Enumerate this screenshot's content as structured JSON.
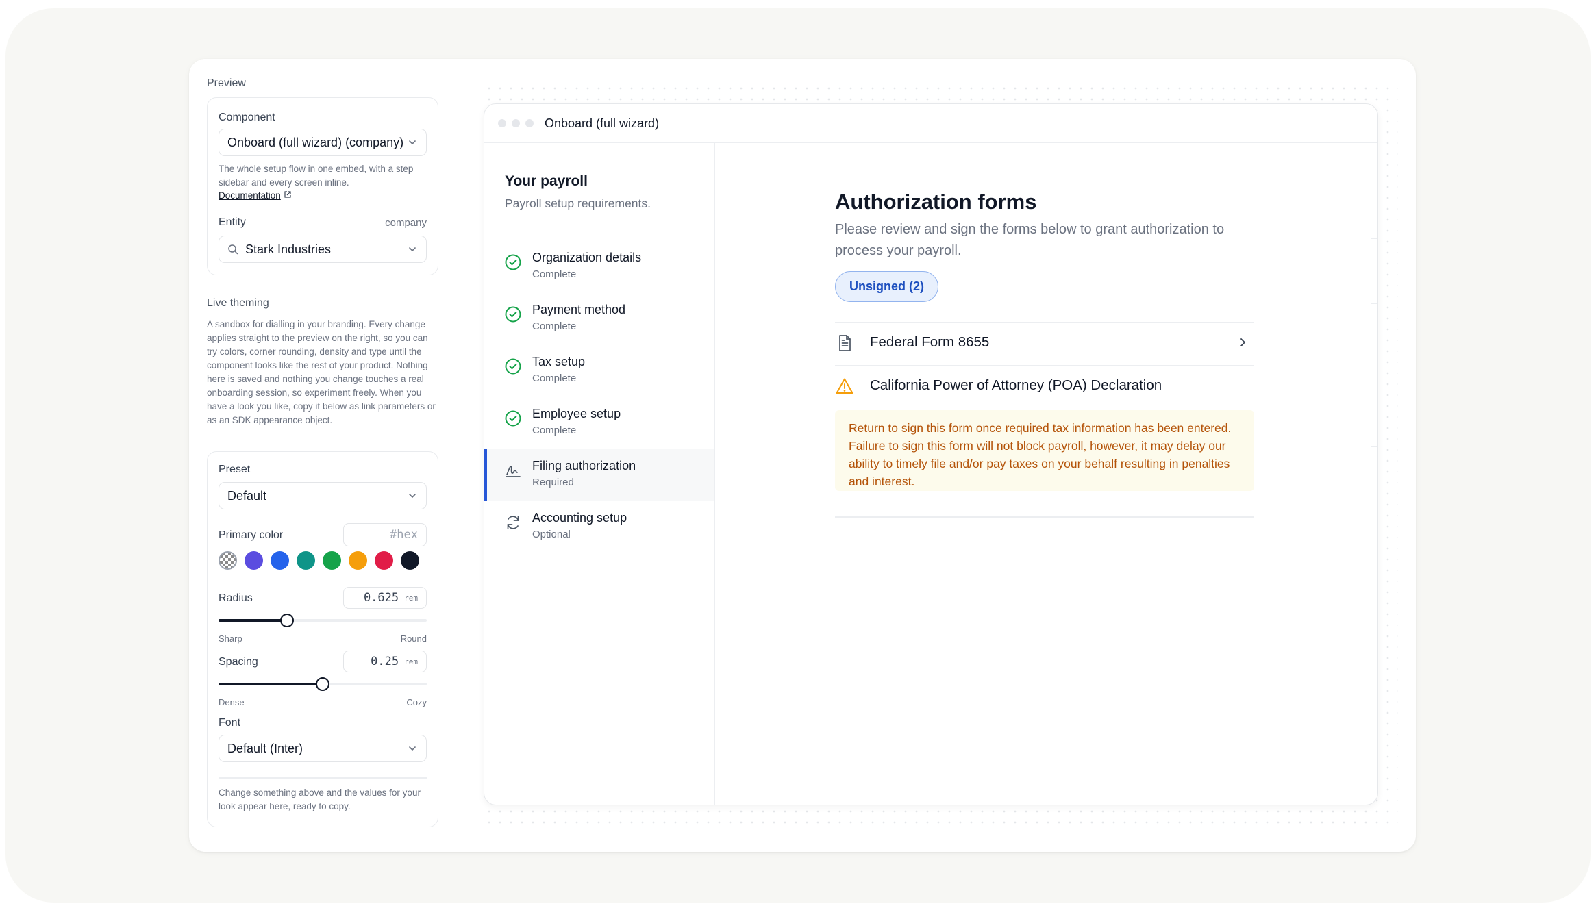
{
  "panel": {
    "preview_label": "Preview",
    "component": {
      "label": "Component",
      "value": "Onboard (full wizard) (company)",
      "description": "The whole setup flow in one embed, with a step sidebar and every screen inline.",
      "doc_link": "Documentation"
    },
    "entity": {
      "label": "Entity",
      "hint": "company",
      "value": "Stark Industries"
    },
    "live_theming": {
      "label": "Live theming",
      "description": "A sandbox for dialling in your branding. Every change applies straight to the preview on the right, so you can try colors, corner rounding, density and type until the component looks like the rest of your product. Nothing here is saved and nothing you change touches a real onboarding session, so experiment freely. When you have a look you like, copy it below as link parameters or as an SDK appearance object."
    },
    "preset": {
      "label": "Preset",
      "value": "Default"
    },
    "primary_color": {
      "label": "Primary color",
      "placeholder": "#hex",
      "swatches": [
        "checker",
        "#5b4de0",
        "#2563eb",
        "#0f9488",
        "#16a34a",
        "#f59e0b",
        "#e11d48",
        "#111827"
      ]
    },
    "radius": {
      "label": "Radius",
      "value": "0.625",
      "unit": "rem",
      "min_label": "Sharp",
      "max_label": "Round",
      "level": 0.33
    },
    "spacing": {
      "label": "Spacing",
      "value": "0.25",
      "unit": "rem",
      "min_label": "Dense",
      "max_label": "Cozy",
      "level": 0.5
    },
    "font": {
      "label": "Font",
      "value": "Default (Inter)"
    },
    "footer_note": "Change something above and the values for your look appear here, ready to copy."
  },
  "preview": {
    "window_title": "Onboard (full wizard)",
    "sidebar": {
      "title": "Your payroll",
      "subtitle": "Payroll setup requirements.",
      "steps": [
        {
          "name": "Organization details",
          "status": "Complete",
          "icon": "check-circle-icon"
        },
        {
          "name": "Payment method",
          "status": "Complete",
          "icon": "check-circle-icon"
        },
        {
          "name": "Tax setup",
          "status": "Complete",
          "icon": "check-circle-icon"
        },
        {
          "name": "Employee setup",
          "status": "Complete",
          "icon": "check-circle-icon"
        },
        {
          "name": "Filing authorization",
          "status": "Required",
          "icon": "signature-icon"
        },
        {
          "name": "Accounting setup",
          "status": "Optional",
          "icon": "refresh-icon"
        }
      ]
    },
    "main": {
      "title": "Authorization forms",
      "description": "Please review and sign the forms below to grant authorization to process your payroll.",
      "filter_pill": "Unsigned (2)",
      "forms": [
        {
          "name": "Federal Form 8655",
          "icon": "document-icon"
        },
        {
          "name": "California Power of Attorney (POA) Declaration",
          "icon": "warning-icon"
        }
      ],
      "warning": "Return to sign this form once required tax information has been entered. Failure to sign this form will not block payroll, however, it may delay our ability to timely file and/or pay taxes on your behalf resulting in penalties and interest."
    },
    "colors": {
      "accent": "#2757d7",
      "success": "#16a34a",
      "warning": "#f59e0b",
      "warning_text": "#b45309",
      "warning_bg": "#fdfbec"
    }
  }
}
